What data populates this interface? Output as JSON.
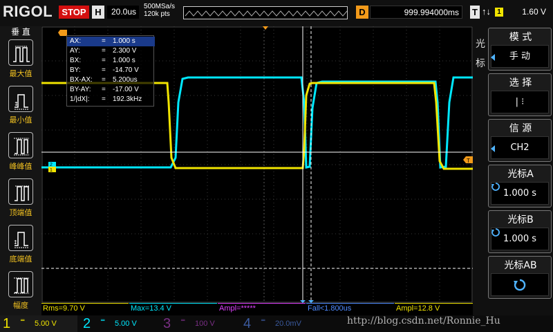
{
  "topbar": {
    "logo": "RIGOL",
    "run_state": "STOP",
    "timebase_label": "H",
    "timebase_value": "20.0us",
    "sample_rate": "500MSa/s",
    "sample_points": "120k pts",
    "delay_label": "D",
    "delay_value": "999.994000ms",
    "trigger_label": "T",
    "trigger_edge": "↑↓",
    "trigger_source": "1",
    "trigger_level": "1.60 V"
  },
  "left_panel": {
    "title": "垂 直",
    "buttons": [
      {
        "label": "最大值",
        "icon": "max-value-icon"
      },
      {
        "label": "最小值",
        "icon": "min-value-icon"
      },
      {
        "label": "峰峰值",
        "icon": "peak-to-peak-icon"
      },
      {
        "label": "顶端值",
        "icon": "top-value-icon"
      },
      {
        "label": "底端值",
        "icon": "base-value-icon"
      },
      {
        "label": "幅度",
        "icon": "amplitude-icon"
      }
    ]
  },
  "cursor_readout": {
    "rows": [
      {
        "key": "AX:",
        "value": "1.000 s"
      },
      {
        "key": "AY:",
        "value": "2.300 V"
      },
      {
        "key": "BX:",
        "value": "1.000 s"
      },
      {
        "key": "BY:",
        "value": "-14.70 V"
      },
      {
        "key": "BX-AX:",
        "value": "5.200us"
      },
      {
        "key": "BY-AY:",
        "value": "-17.00 V"
      },
      {
        "key": "1/|dX|:",
        "value": "192.3kHz"
      }
    ]
  },
  "right_panel": {
    "side_label": "光标",
    "mode": {
      "title": "模 式",
      "value": "手 动"
    },
    "select": {
      "title": "选 择",
      "value": "|  ⁝"
    },
    "source": {
      "title": "信 源",
      "value": "CH2"
    },
    "cursor_a": {
      "title": "光标A",
      "value": "1.000 s"
    },
    "cursor_b": {
      "title": "光标B",
      "value": "1.000 s"
    },
    "cursor_ab": {
      "title": "光标AB"
    }
  },
  "measurements": [
    {
      "text": "Rms=9.70 V",
      "color": "#f1e400"
    },
    {
      "text": "Max=13.4 V",
      "color": "#00e8ff"
    },
    {
      "text": "Ampl=*****",
      "color": "#e040ff"
    },
    {
      "text": "Fall<1.800us",
      "color": "#4f8bff"
    },
    {
      "text": "Ampl=12.8 V",
      "color": "#f1e400"
    }
  ],
  "channels": [
    {
      "num": "1",
      "coupling": "═",
      "scale": "5.00 V",
      "color": "#f1e400",
      "active": true
    },
    {
      "num": "2",
      "coupling": "═",
      "scale": "5.00 V",
      "color": "#00e8ff",
      "active": true
    },
    {
      "num": "3",
      "coupling": "═",
      "scale": "100 V",
      "color": "#e040ff",
      "active": false
    },
    {
      "num": "4",
      "coupling": "═",
      "scale": "20.0mV",
      "color": "#4f8bff",
      "active": false
    }
  ],
  "watermark": "http://blog.csdn.net/Ronnie_Hu",
  "markers": {
    "ch1": "1",
    "ch2": "2",
    "trigger": "T"
  },
  "colors": {
    "ch1": "#f1e400",
    "ch2": "#00e8ff",
    "grid": "#444444",
    "cursor": "#ffffff"
  }
}
